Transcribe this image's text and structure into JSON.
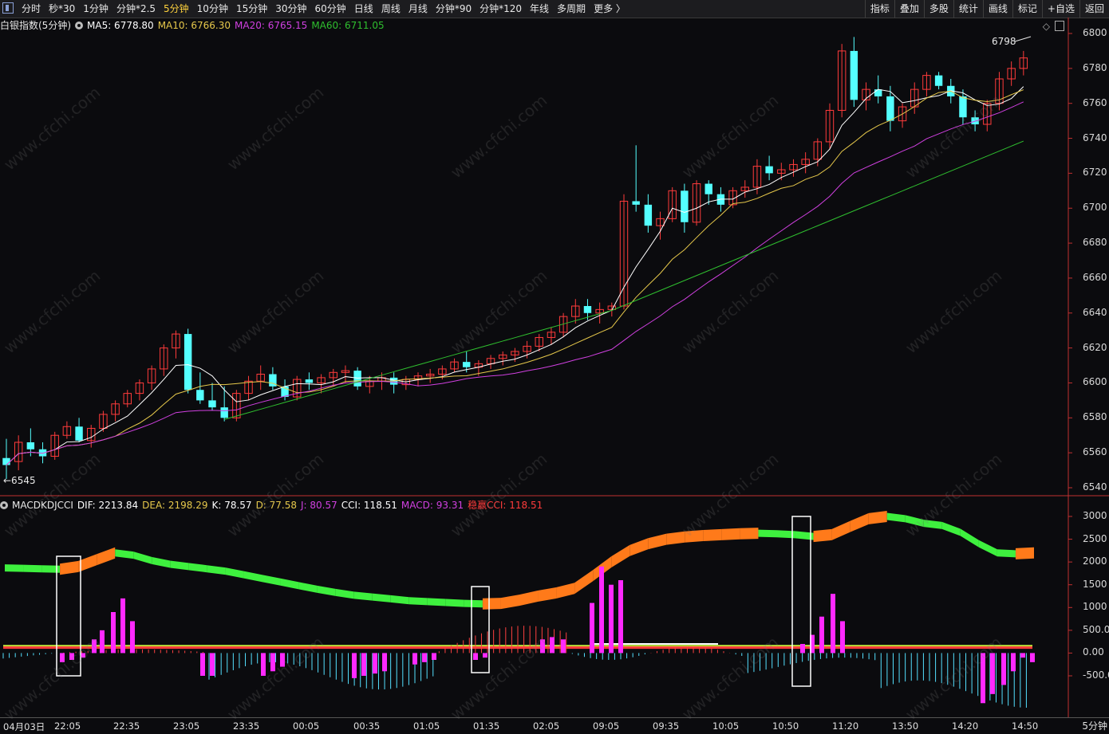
{
  "toolbar": {
    "periods": [
      "分时",
      "秒*30",
      "1分钟",
      "分钟*2.5",
      "5分钟",
      "10分钟",
      "15分钟",
      "30分钟",
      "60分钟",
      "日线",
      "周线",
      "月线",
      "分钟*90",
      "分钟*120",
      "年线",
      "多周期",
      "更多 〉"
    ],
    "active_period": "5分钟",
    "right_buttons": [
      "指标",
      "叠加",
      "多股",
      "统计",
      "画线",
      "标记",
      "+自选",
      "返回"
    ]
  },
  "price_panel": {
    "instrument": "白银指数(5分钟)",
    "ma5": "MA5: 6778.80",
    "ma10": "MA10: 6766.30",
    "ma20": "MA20: 6765.15",
    "ma60": "MA60: 6711.05",
    "high_marker": "6798",
    "low_marker": "←6545"
  },
  "indicator_panel": {
    "name": "MACDKDJCCI",
    "dif": "DIF: 2213.84",
    "dea": "DEA: 2198.29",
    "k": "K: 78.57",
    "d": "D: 77.58",
    "j": "J: 80.57",
    "cci": "CCI: 118.51",
    "macd": "MACD: 93.31",
    "wcci": "稳赢CCI: 118.51"
  },
  "price_axis": [
    "6800",
    "6780",
    "6760",
    "6740",
    "6720",
    "6700",
    "6680",
    "6660",
    "6640",
    "6620",
    "6600",
    "6580",
    "6560",
    "6540"
  ],
  "indicator_axis": [
    "3000",
    "2500",
    "2000",
    "1500",
    "1000",
    "500.0",
    "0.00",
    "-500.0"
  ],
  "time_axis": [
    "04月03日",
    "22:05",
    "22:35",
    "23:05",
    "23:35",
    "00:05",
    "00:35",
    "01:05",
    "01:35",
    "02:05",
    "09:05",
    "09:35",
    "10:05",
    "10:50",
    "11:20",
    "13:50",
    "14:20",
    "14:50"
  ],
  "period_tag": "5分钟",
  "watermark": "www.cfchi.com",
  "colors": {
    "up": "#ff3b3b",
    "down": "#54ffff",
    "ma5": "#ffffff",
    "ma10": "#e6c84b",
    "ma20": "#d040e0",
    "ma60": "#2fbf2f",
    "orange": "#ff7a1a",
    "green": "#3ef03e",
    "magenta": "#ff29ff"
  },
  "chart_data": {
    "type": "candlestick",
    "price_ylim": [
      6540,
      6800
    ],
    "indicator_ylim": [
      -500,
      3000
    ],
    "ohlc": [
      [
        6557,
        6568,
        6545,
        6553
      ],
      [
        6555,
        6570,
        6550,
        6566
      ],
      [
        6566,
        6574,
        6558,
        6562
      ],
      [
        6562,
        6566,
        6554,
        6558
      ],
      [
        6558,
        6572,
        6556,
        6570
      ],
      [
        6570,
        6578,
        6568,
        6575
      ],
      [
        6575,
        6580,
        6566,
        6567
      ],
      [
        6567,
        6576,
        6563,
        6574
      ],
      [
        6574,
        6584,
        6572,
        6582
      ],
      [
        6582,
        6590,
        6578,
        6588
      ],
      [
        6588,
        6596,
        6586,
        6594
      ],
      [
        6594,
        6602,
        6590,
        6600
      ],
      [
        6600,
        6610,
        6596,
        6608
      ],
      [
        6608,
        6622,
        6604,
        6620
      ],
      [
        6620,
        6630,
        6614,
        6628
      ],
      [
        6628,
        6631,
        6594,
        6596
      ],
      [
        6596,
        6606,
        6588,
        6590
      ],
      [
        6590,
        6600,
        6584,
        6586
      ],
      [
        6586,
        6598,
        6578,
        6580
      ],
      [
        6580,
        6596,
        6578,
        6594
      ],
      [
        6594,
        6604,
        6590,
        6601
      ],
      [
        6601,
        6610,
        6596,
        6605
      ],
      [
        6605,
        6609,
        6596,
        6598
      ],
      [
        6598,
        6602,
        6590,
        6592
      ],
      [
        6592,
        6604,
        6590,
        6602
      ],
      [
        6602,
        6606,
        6596,
        6600
      ],
      [
        6600,
        6605,
        6594,
        6603
      ],
      [
        6603,
        6608,
        6598,
        6606
      ],
      [
        6606,
        6610,
        6600,
        6607
      ],
      [
        6607,
        6609,
        6596,
        6598
      ],
      [
        6598,
        6604,
        6594,
        6601
      ],
      [
        6601,
        6606,
        6596,
        6603
      ],
      [
        6603,
        6606,
        6594,
        6599
      ],
      [
        6599,
        6604,
        6596,
        6602
      ],
      [
        6602,
        6606,
        6598,
        6604
      ],
      [
        6604,
        6608,
        6600,
        6605
      ],
      [
        6605,
        6610,
        6602,
        6608
      ],
      [
        6608,
        6614,
        6606,
        6612
      ],
      [
        6612,
        6618,
        6606,
        6609
      ],
      [
        6609,
        6613,
        6604,
        6611
      ],
      [
        6611,
        6616,
        6608,
        6614
      ],
      [
        6614,
        6618,
        6610,
        6616
      ],
      [
        6616,
        6620,
        6612,
        6618
      ],
      [
        6618,
        6624,
        6614,
        6621
      ],
      [
        6621,
        6628,
        6618,
        6626
      ],
      [
        6626,
        6632,
        6622,
        6629
      ],
      [
        6629,
        6640,
        6626,
        6638
      ],
      [
        6638,
        6648,
        6634,
        6644
      ],
      [
        6644,
        6648,
        6636,
        6640
      ],
      [
        6640,
        6646,
        6634,
        6642
      ],
      [
        6642,
        6646,
        6638,
        6644
      ],
      [
        6644,
        6708,
        6642,
        6704
      ],
      [
        6704,
        6736,
        6698,
        6702
      ],
      [
        6702,
        6708,
        6686,
        6690
      ],
      [
        6690,
        6698,
        6682,
        6694
      ],
      [
        6694,
        6712,
        6692,
        6710
      ],
      [
        6710,
        6714,
        6686,
        6692
      ],
      [
        6692,
        6716,
        6690,
        6714
      ],
      [
        6714,
        6716,
        6702,
        6708
      ],
      [
        6708,
        6712,
        6698,
        6702
      ],
      [
        6702,
        6712,
        6700,
        6710
      ],
      [
        6710,
        6716,
        6706,
        6712
      ],
      [
        6712,
        6728,
        6708,
        6724
      ],
      [
        6724,
        6730,
        6716,
        6720
      ],
      [
        6720,
        6726,
        6716,
        6722
      ],
      [
        6722,
        6728,
        6718,
        6725
      ],
      [
        6725,
        6732,
        6720,
        6728
      ],
      [
        6728,
        6740,
        6724,
        6738
      ],
      [
        6738,
        6760,
        6734,
        6756
      ],
      [
        6756,
        6794,
        6752,
        6790
      ],
      [
        6790,
        6798,
        6758,
        6762
      ],
      [
        6762,
        6772,
        6756,
        6768
      ],
      [
        6768,
        6776,
        6760,
        6764
      ],
      [
        6764,
        6770,
        6744,
        6750
      ],
      [
        6750,
        6760,
        6746,
        6758
      ],
      [
        6758,
        6772,
        6754,
        6768
      ],
      [
        6768,
        6778,
        6764,
        6776
      ],
      [
        6776,
        6778,
        6768,
        6770
      ],
      [
        6770,
        6774,
        6760,
        6764
      ],
      [
        6764,
        6768,
        6748,
        6752
      ],
      [
        6752,
        6756,
        6744,
        6748
      ],
      [
        6748,
        6762,
        6744,
        6760
      ],
      [
        6760,
        6778,
        6756,
        6774
      ],
      [
        6774,
        6784,
        6770,
        6780
      ],
      [
        6780,
        6790,
        6776,
        6786
      ]
    ]
  }
}
